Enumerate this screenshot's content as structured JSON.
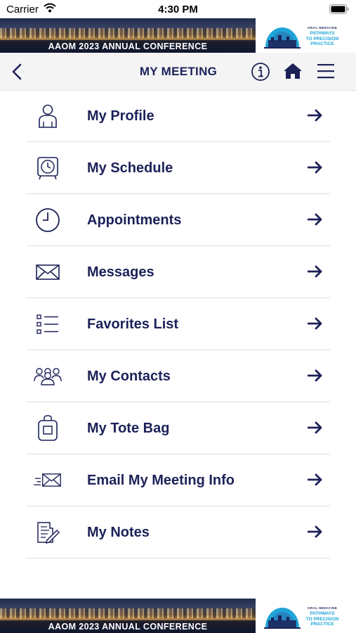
{
  "status_bar": {
    "carrier": "Carrier",
    "time": "4:30 PM"
  },
  "banner": {
    "title": "AAOM 2023 ANNUAL CONFERENCE",
    "logo_small_text": "ORAL MEDICINE",
    "logo_line1": "PATHWAYS",
    "logo_line2": "TO PRECISION",
    "logo_line3": "PRACTICE"
  },
  "header": {
    "title": "MY MEETING"
  },
  "menu": {
    "items": [
      {
        "label": "My Profile",
        "icon": "person-icon"
      },
      {
        "label": "My Schedule",
        "icon": "alarm-clock-icon"
      },
      {
        "label": "Appointments",
        "icon": "clock-icon"
      },
      {
        "label": "Messages",
        "icon": "envelope-icon"
      },
      {
        "label": "Favorites List",
        "icon": "checklist-icon"
      },
      {
        "label": "My Contacts",
        "icon": "group-icon"
      },
      {
        "label": "My Tote Bag",
        "icon": "tote-bag-icon"
      },
      {
        "label": "Email My Meeting Info",
        "icon": "send-mail-icon"
      },
      {
        "label": "My Notes",
        "icon": "notes-icon"
      }
    ]
  },
  "colors": {
    "primary": "#1c2158",
    "accent": "#1fa5d8",
    "navbar_bg": "#f4f4f5",
    "divider": "#dedee2"
  }
}
